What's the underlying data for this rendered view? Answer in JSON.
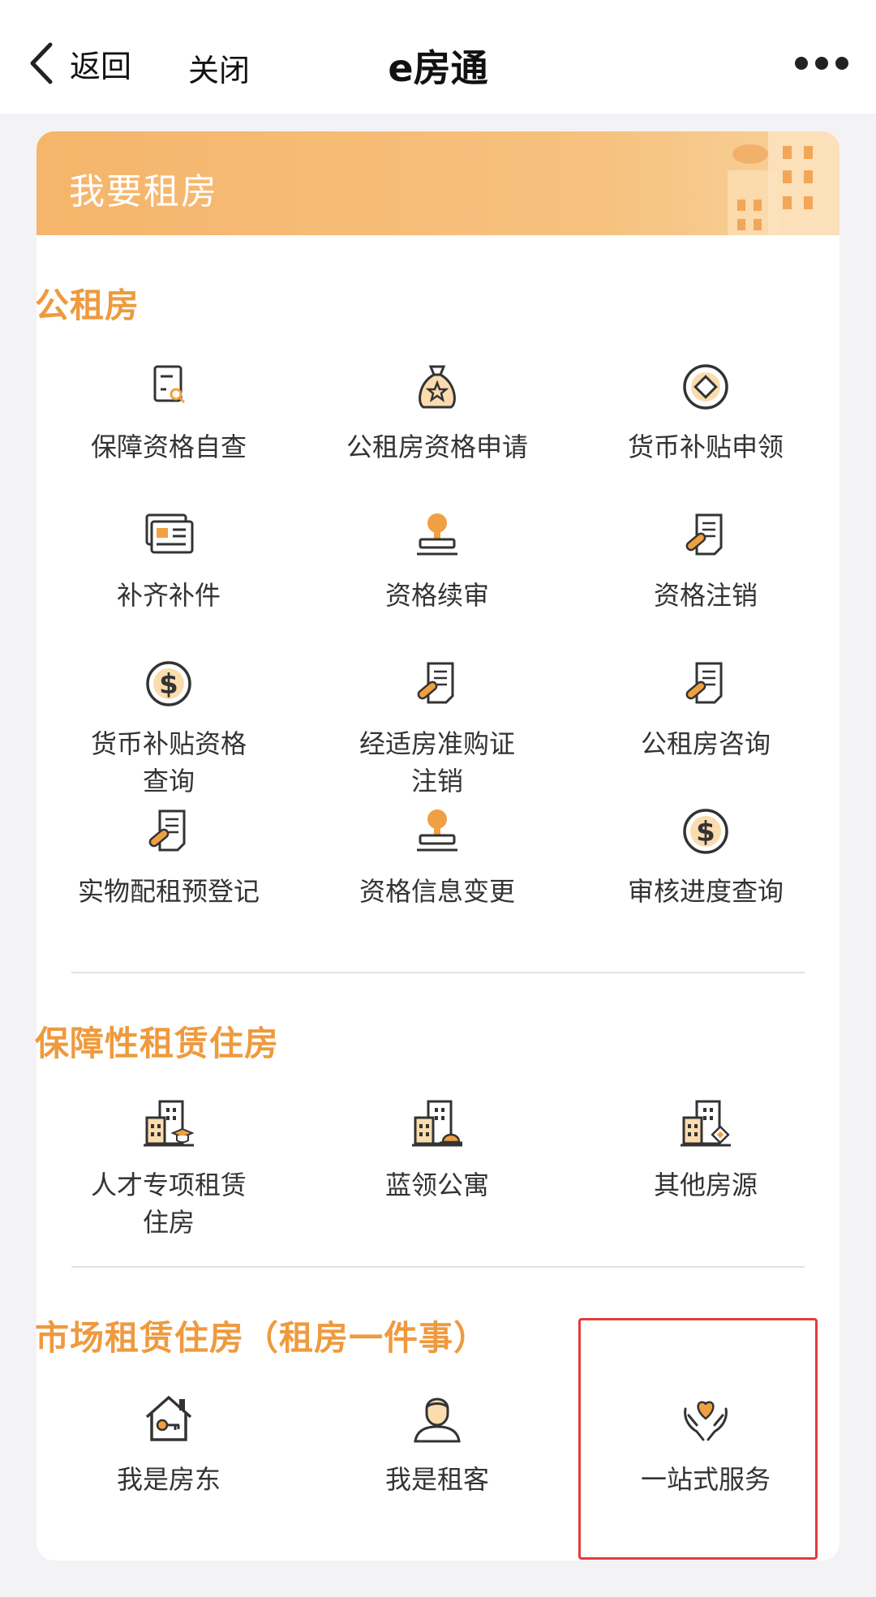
{
  "nav": {
    "back_label": "返回",
    "close_label": "关闭",
    "title": "e房通"
  },
  "card": {
    "header_title": "我要租房",
    "sections": [
      {
        "title": "公租房",
        "items": [
          {
            "label": "保障资格自查",
            "icon": "document-search-icon"
          },
          {
            "label": "公租房资格申请",
            "icon": "money-bag-star-icon"
          },
          {
            "label": "货币补贴申领",
            "icon": "coin-diamond-icon"
          },
          {
            "label": "补齐补件",
            "icon": "id-cards-icon"
          },
          {
            "label": "资格续审",
            "icon": "stamp-icon"
          },
          {
            "label": "资格注销",
            "icon": "document-clip-icon"
          },
          {
            "label": "货币补贴资格\n查询",
            "icon": "dollar-coin-icon"
          },
          {
            "label": "经适房准购证\n注销",
            "icon": "document-clip-icon"
          },
          {
            "label": "公租房咨询",
            "icon": "document-clip-icon"
          },
          {
            "label": "实物配租预登记",
            "icon": "document-clip-icon"
          },
          {
            "label": "资格信息变更",
            "icon": "stamp-icon"
          },
          {
            "label": "审核进度查询",
            "icon": "dollar-coin-icon"
          }
        ]
      },
      {
        "title": "保障性租赁住房",
        "items": [
          {
            "label": "人才专项租赁\n住房",
            "icon": "building-graduate-icon"
          },
          {
            "label": "蓝领公寓",
            "icon": "building-helmet-icon"
          },
          {
            "label": "其他房源",
            "icon": "building-diamond-icon"
          }
        ]
      },
      {
        "title": "市场租赁住房（租房一件事）",
        "items": [
          {
            "label": "我是房东",
            "icon": "house-key-icon"
          },
          {
            "label": "我是租客",
            "icon": "person-icon"
          },
          {
            "label": "一站式服务",
            "icon": "hands-heart-icon"
          }
        ]
      }
    ]
  },
  "colors": {
    "accent": "#ee9a3e",
    "header_gradient_start": "#f5b56b",
    "header_gradient_end": "#f8d29c",
    "highlight_border": "#e23c3c"
  }
}
